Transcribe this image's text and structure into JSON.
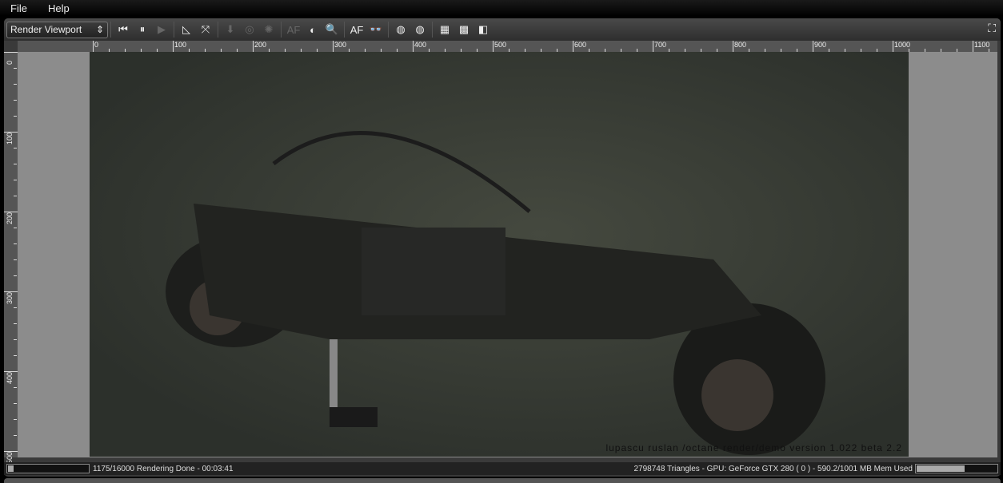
{
  "menu": [
    "File",
    "Help"
  ],
  "toolbar": {
    "view_select": "Render Viewport",
    "buttons": [
      {
        "icon": "restart-icon",
        "glyph": "⏮",
        "enabled": true
      },
      {
        "icon": "pause-icon",
        "glyph": "⏸",
        "enabled": true
      },
      {
        "icon": "play-icon",
        "glyph": "▶",
        "enabled": false
      },
      {
        "icon": "set-square-icon",
        "glyph": "◺",
        "enabled": true
      },
      {
        "icon": "fit-region-icon",
        "glyph": "⤧",
        "enabled": true
      },
      {
        "icon": "pick-object-icon",
        "glyph": "⬇",
        "enabled": false
      },
      {
        "icon": "pick-material-icon",
        "glyph": "◎",
        "enabled": false
      },
      {
        "icon": "pick-light-icon",
        "glyph": "✺",
        "enabled": false
      },
      {
        "icon": "pick-focus-icon",
        "glyph": "AF",
        "enabled": false
      },
      {
        "icon": "pick-white-point-icon",
        "glyph": "◐",
        "enabled": true
      },
      {
        "icon": "zoom-pick-icon",
        "glyph": "🔍",
        "enabled": true
      },
      {
        "icon": "autofocus-icon",
        "glyph": "AF",
        "enabled": true
      },
      {
        "icon": "stereo-glasses-icon",
        "glyph": "👓",
        "enabled": true
      },
      {
        "icon": "clay-render-icon",
        "glyph": "◍",
        "enabled": true
      },
      {
        "icon": "clay-render-alt-icon",
        "glyph": "◍",
        "enabled": true
      },
      {
        "icon": "alpha-grey-icon",
        "glyph": "▦",
        "enabled": true
      },
      {
        "icon": "alpha-checker-icon",
        "glyph": "▩",
        "enabled": true
      },
      {
        "icon": "alpha-split-icon",
        "glyph": "◧",
        "enabled": true
      }
    ],
    "fullscreen_icon": "fullscreen-icon"
  },
  "ruler": {
    "h_labels": [
      "0",
      "100",
      "200",
      "300",
      "400",
      "500",
      "600",
      "700",
      "800",
      "900",
      "1000",
      "1100"
    ],
    "v_labels": [
      "0",
      "100",
      "200",
      "300",
      "400",
      "500"
    ]
  },
  "render": {
    "watermark": "lupascu ruslan /octane render/demo version 1.022 beta 2.2"
  },
  "status": {
    "left": "1175/16000 Rendering Done - 00:03:41",
    "right": "2798748 Triangles - GPU: GeForce GTX 280 ( 0 ) - 590.2/1001 MB Mem Used",
    "render_progress": 0.073,
    "memory_usage": 0.59
  }
}
